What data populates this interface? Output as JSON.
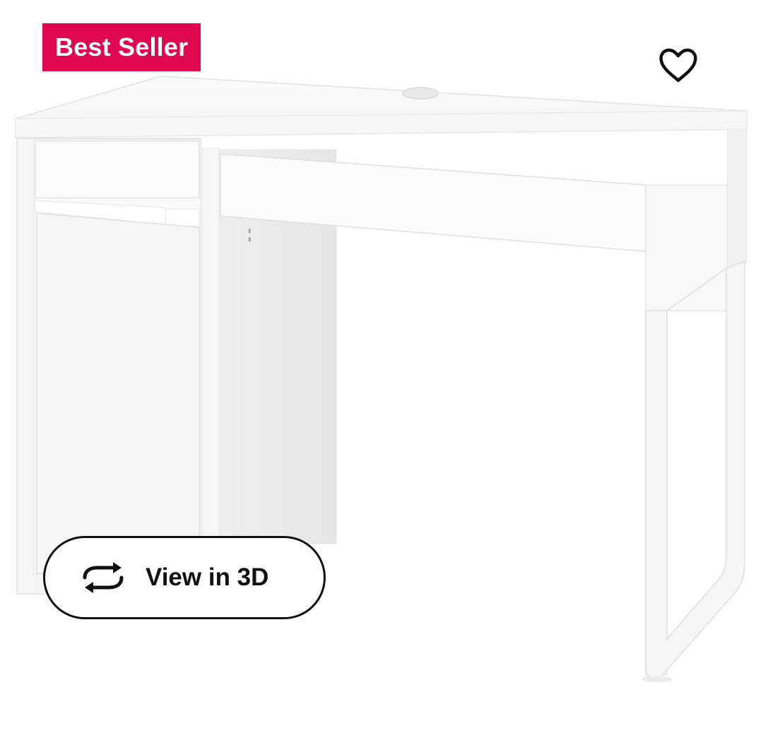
{
  "badge": {
    "label": "Best Seller",
    "bg_color": "#E00751",
    "text_color": "#FFFFFF"
  },
  "favorite": {
    "icon": "heart-outline-icon",
    "color": "#111111"
  },
  "view_3d": {
    "label": "View in 3D",
    "icon": "rotate-arrows-icon"
  },
  "product": {
    "image": "white-desk-with-drawers-and-cabinet"
  }
}
